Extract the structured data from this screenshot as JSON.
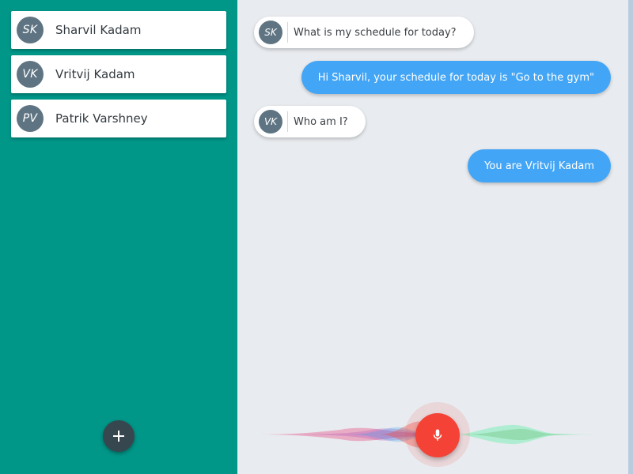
{
  "colors": {
    "sidebar_bg": "#009688",
    "chat_bg": "#e8ebef",
    "avatar_bg": "#5f7482",
    "outgoing_bubble": "#42a5f5",
    "mic_button": "#f44336",
    "fab_add": "#37474f"
  },
  "sidebar": {
    "users": [
      {
        "initials": "SK",
        "name": "Sharvil Kadam"
      },
      {
        "initials": "VK",
        "name": "Vritvij Kadam"
      },
      {
        "initials": "PV",
        "name": "Patrik Varshney"
      }
    ],
    "add_button_icon": "plus-icon"
  },
  "chat": {
    "messages": [
      {
        "direction": "incoming",
        "initials": "SK",
        "text": "What is my schedule for today?"
      },
      {
        "direction": "outgoing",
        "text": "Hi Sharvil, your schedule for today is \"Go to the gym\""
      },
      {
        "direction": "incoming",
        "initials": "VK",
        "text": "Who am I?"
      },
      {
        "direction": "outgoing",
        "text": "You are Vritvij Kadam"
      }
    ]
  },
  "voice": {
    "mic_button_icon": "microphone-icon",
    "waveform_icon": "voice-waveform-icon"
  }
}
